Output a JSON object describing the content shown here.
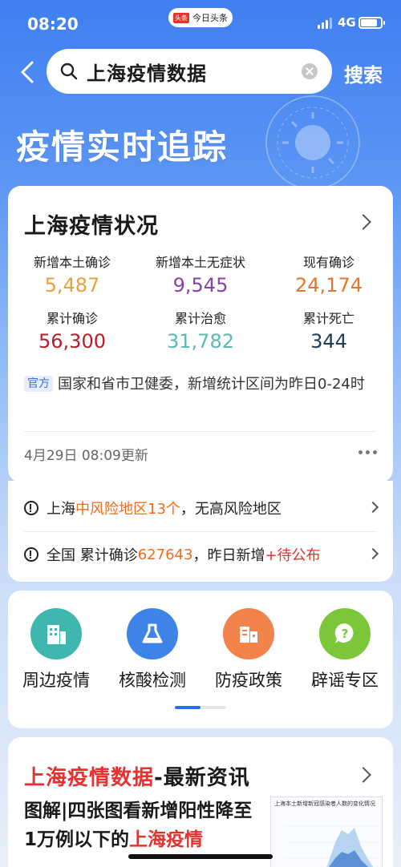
{
  "status": {
    "time": "08:20",
    "app_name": "今日头条",
    "app_logo_text": "头条",
    "network": "4G"
  },
  "search": {
    "query": "上海疫情数据",
    "button": "搜索"
  },
  "banner": {
    "title": "疫情实时追踪"
  },
  "summary": {
    "title": "上海疫情状况",
    "stats": [
      {
        "label": "新增本土确诊",
        "value": "5,487",
        "color": "#e8a13a"
      },
      {
        "label": "新增本土无症状",
        "value": "9,545",
        "color": "#8a3fa8"
      },
      {
        "label": "现有确诊",
        "value": "24,174",
        "color": "#e2762d"
      },
      {
        "label": "累计确诊",
        "value": "56,300",
        "color": "#b81c2c"
      },
      {
        "label": "累计治愈",
        "value": "31,782",
        "color": "#5bb9b4"
      },
      {
        "label": "累计死亡",
        "value": "344",
        "color": "#213a5c"
      }
    ],
    "source_badge": "官方",
    "source_text": "国家和省市卫健委，新增统计区间为昨日0-24时",
    "updated": "4月29日 08:09更新"
  },
  "risk": {
    "row1": {
      "prefix": "上海",
      "highlight": "中风险地区13个",
      "suffix": "，无高风险地区"
    },
    "row2": {
      "prefix": "全国 累计确诊",
      "count": "627643",
      "middle": "，昨日新增",
      "highlight": "+待公布"
    }
  },
  "services": [
    {
      "label": "周边疫情",
      "icon": "building-icon",
      "color": "#3fb6ae"
    },
    {
      "label": "核酸检测",
      "icon": "flask-icon",
      "color": "#3e84e8"
    },
    {
      "label": "防疫政策",
      "icon": "document-building-icon",
      "color": "#f2834a"
    },
    {
      "label": "辟谣专区",
      "icon": "question-bubble-icon",
      "color": "#7cc63a"
    }
  ],
  "news": {
    "title_highlight": "上海疫情数据",
    "title_rest": "-最新资讯",
    "headline_plain": "图解|四张图看新增阳性降至1万例以下的",
    "headline_highlight": "上海疫情",
    "thumbnail_title": "上海本土新增新冠感染者人数的变化情况"
  }
}
